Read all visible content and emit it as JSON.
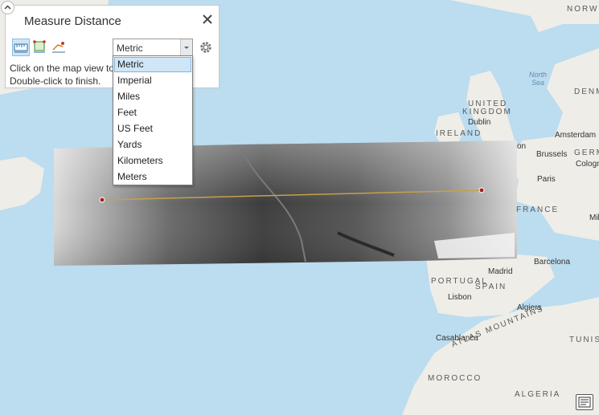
{
  "panel": {
    "title": "Measure Distance",
    "hint_line1": "Click on the map view to",
    "hint_line2": "Double-click to finish.",
    "tools": [
      "measure-distance-icon",
      "measure-area-icon",
      "measure-features-icon"
    ],
    "unit_select": {
      "value": "Metric",
      "options": [
        "Metric",
        "Imperial",
        "Miles",
        "Feet",
        "US Feet",
        "Yards",
        "Kilometers",
        "Meters"
      ],
      "highlighted": "Metric"
    }
  },
  "map": {
    "countries": [
      "NORW",
      "UNITED",
      "KINGDOM",
      "IRELAND",
      "GERM",
      "DENM",
      "FRANCE",
      "PORTUGAL",
      "SPAIN",
      "ATLAS MOUNTAINS",
      "TUNISI",
      "MOROCCO",
      "ALGERIA"
    ],
    "cities": [
      "Dublin",
      "Amsterdam",
      "Brussels",
      "Cologn",
      "Paris",
      "Mil",
      "Madrid",
      "Barcelona",
      "Lisbon",
      "Algiers",
      "Casablanca",
      "on"
    ],
    "seas": [
      "North",
      "Sea"
    ],
    "colors": {
      "water": "#bcdcef",
      "land": "#f0efe9",
      "measure_line": "#c5a14b",
      "vertex": "#a32020",
      "accent": "#cfe6f7"
    }
  },
  "legend_button": "legend-icon"
}
